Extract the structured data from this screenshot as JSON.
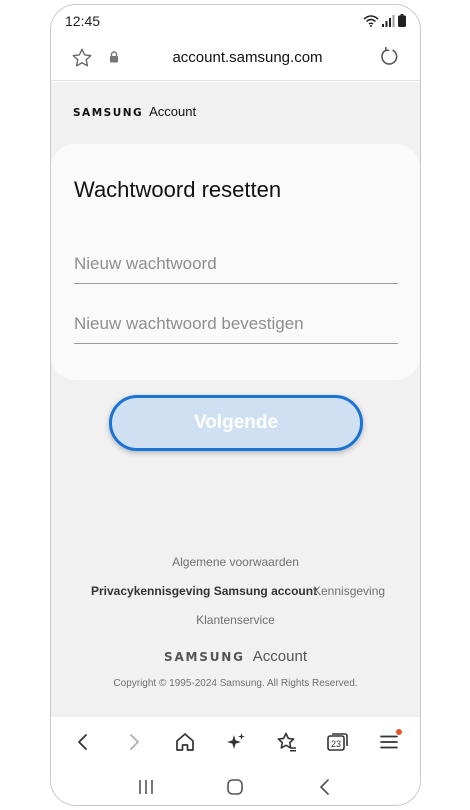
{
  "status_bar": {
    "time": "12:45"
  },
  "browser": {
    "url": "account.samsung.com"
  },
  "brand": {
    "wordmark": "SAMSUNG",
    "product": "Account"
  },
  "form": {
    "title": "Wachtwoord resetten",
    "new_password_placeholder": "Nieuw wachtwoord",
    "confirm_password_placeholder": "Nieuw wachtwoord bevestigen",
    "next_label": "Volgende"
  },
  "footer": {
    "terms": "Algemene voorwaarden",
    "privacy": "Privacykennisgeving Samsung account",
    "notice": "Kennisgeving",
    "support": "Klantenservice",
    "wordmark": "SAMSUNG",
    "product": "Account",
    "copyright": "Copyright © 1995-2024 Samsung. All Rights Reserved."
  },
  "toolbar": {
    "tab_count": "23",
    "icons": [
      "back-icon",
      "forward-icon",
      "home-icon",
      "ai-sparkle-icon",
      "bookmarks-icon",
      "tabs-icon",
      "menu-icon"
    ]
  },
  "colors": {
    "accent": "#1a73d6",
    "button_fill": "#cfe0f3",
    "background": "#f1f1f1",
    "notification_dot": "#e8542a"
  }
}
